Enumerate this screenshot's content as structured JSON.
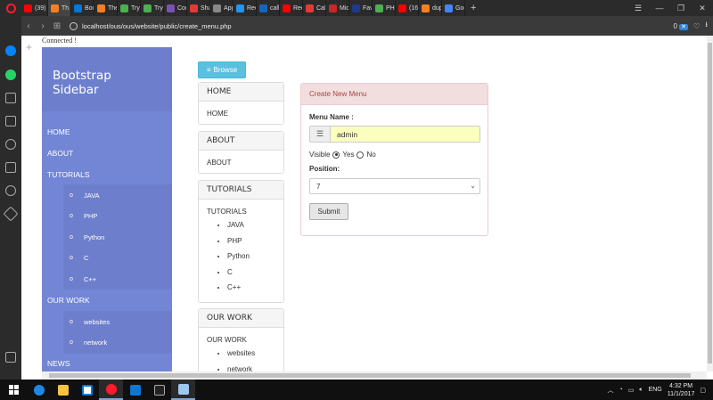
{
  "browser": {
    "tabs": [
      {
        "label": "(39)",
        "color": "#ff0000",
        "active": false
      },
      {
        "label": "Th",
        "color": "#f48024",
        "active": true
      },
      {
        "label": "Boot",
        "color": "#0078d7",
        "active": false
      },
      {
        "label": "The",
        "color": "#f48024",
        "active": false
      },
      {
        "label": "TryIt",
        "color": "#4caf50",
        "active": false
      },
      {
        "label": "TryIt",
        "color": "#4caf50",
        "active": false
      },
      {
        "label": "Com",
        "color": "#7952b3",
        "active": false
      },
      {
        "label": "Shar",
        "color": "#e53935",
        "active": false
      },
      {
        "label": "App",
        "color": "#888888",
        "active": false
      },
      {
        "label": "Recu",
        "color": "#2196f3",
        "active": false
      },
      {
        "label": "call",
        "color": "#1565c0",
        "active": false
      },
      {
        "label": "Reco",
        "color": "#ff0000",
        "active": false
      },
      {
        "label": "Call",
        "color": "#e53935",
        "active": false
      },
      {
        "label": "Micr",
        "color": "#c62828",
        "active": false
      },
      {
        "label": "Favi",
        "color": "#1e3a8a",
        "active": false
      },
      {
        "label": "PHF",
        "color": "#4caf50",
        "active": false
      },
      {
        "label": "(16)",
        "color": "#ff0000",
        "active": false
      },
      {
        "label": "dupl",
        "color": "#f48024",
        "active": false
      },
      {
        "label": "Goo",
        "color": "#4285f4",
        "active": false
      }
    ],
    "tab_badges": {
      "bootstrap": "B",
      "favicon": "BL"
    },
    "new_tab": "+",
    "url": "localhost/ous/ous/website/public/create_menu.php",
    "ad_count": "0"
  },
  "page": {
    "status": "Connected !",
    "sidebar": {
      "title_line1": "Bootstrap",
      "title_line2": "Sidebar",
      "items": {
        "home": "HOME",
        "about": "ABOUT",
        "tutorials": "TUTORIALS",
        "our_work": "OUR WORK",
        "news": "NEWS"
      },
      "tutorials_sub": [
        "JAVA",
        "PHP",
        "Python",
        "C",
        "C++"
      ],
      "work_sub": [
        "websites",
        "network"
      ],
      "bullet": "o"
    },
    "browse_button": "Browse",
    "panels": [
      {
        "heading": "HOME",
        "body": "HOME",
        "list": []
      },
      {
        "heading": "ABOUT",
        "body": "ABOUT",
        "list": []
      },
      {
        "heading": "TUTORIALS",
        "body": "TUTORIALS",
        "list": [
          "JAVA",
          "PHP",
          "Python",
          "C",
          "C++"
        ]
      },
      {
        "heading": "OUR WORK",
        "body": "OUR WORK",
        "list": [
          "websites",
          "network"
        ]
      }
    ],
    "form": {
      "heading": "Create New Menu",
      "menu_name_label": "Menu Name :",
      "menu_name_value": "admin",
      "visible_label": "Visible",
      "yes_label": "Yes",
      "no_label": "No",
      "visible_selected": "Yes",
      "position_label": "Position:",
      "position_value": "7",
      "submit_label": "Submit"
    }
  },
  "taskbar": {
    "language": "ENG",
    "time": "4:32 PM",
    "date": "11/1/2017"
  }
}
